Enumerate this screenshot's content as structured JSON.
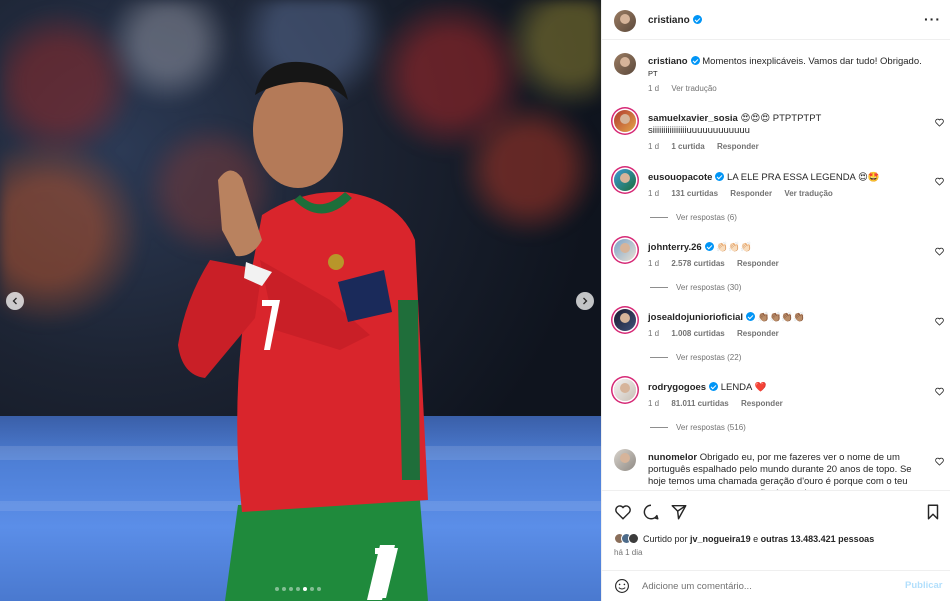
{
  "post": {
    "username": "cristiano",
    "more_icon": "ellipsis-icon",
    "caption": "Momentos inexplicáveis. Vamos dar tudo! Obrigado.",
    "caption_tag": "PT",
    "age": "1 d",
    "translate": "Ver tradução"
  },
  "carousel": {
    "total_slides": 7,
    "current_slide": 5
  },
  "comments": [
    {
      "user": "samuelxavier_sosia",
      "verified": false,
      "text": "😍😍😍 PTPTPTPT",
      "text2": "siiiiiiiiiiiiiiiiuuuuuuuuuuuu",
      "age": "1 d",
      "likes": "1 curtida",
      "reply": "Responder"
    },
    {
      "user": "eusouopacote",
      "verified": true,
      "text": "LA ELE PRA ESSA LEGENDA 😍🤩",
      "age": "1 d",
      "likes": "131 curtidas",
      "reply": "Responder",
      "translate": "Ver tradução",
      "replies": "Ver respostas (6)"
    },
    {
      "user": "johnterry.26",
      "verified": true,
      "text": "👏🏻👏🏻👏🏻",
      "age": "1 d",
      "likes": "2.578 curtidas",
      "reply": "Responder",
      "replies": "Ver respostas (30)"
    },
    {
      "user": "josealdojuniorioficial",
      "verified": true,
      "text": "👏🏽👏🏽👏🏽👏🏽",
      "age": "1 d",
      "likes": "1.008 curtidas",
      "reply": "Responder",
      "replies": "Ver respostas (22)"
    },
    {
      "user": "rodrygogoes",
      "verified": true,
      "text": "LENDA ❤️",
      "age": "1 d",
      "likes": "81.011 curtidas",
      "reply": "Responder",
      "replies": "Ver respostas (516)"
    },
    {
      "user": "nunomelor",
      "verified": false,
      "text": "Obrigado eu, por me fazeres ver o nome de um português espalhado pelo mundo durante 20 anos de topo. Se hoje temos uma chamada geração d'ouro é porque com o teu exemplo houve uma geração de cracks"
    }
  ],
  "actions": {
    "liked_by_prefix": "Curtido por",
    "liked_by_user": "jv_nogueira19",
    "liked_by_suffix": "e",
    "others": "outras 13.483.421 pessoas",
    "age": "há 1 dia"
  },
  "add_comment": {
    "placeholder": "Adicione um comentário...",
    "publish": "Publicar"
  },
  "colors": {
    "accent": "#0095f6",
    "like_red": "#ed4956",
    "muted": "#737373"
  }
}
